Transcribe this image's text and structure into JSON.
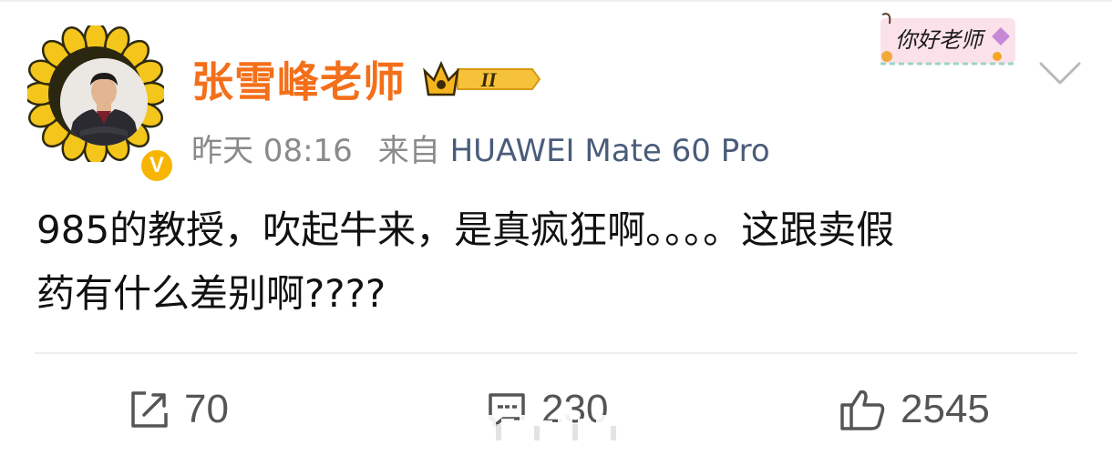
{
  "post": {
    "author": {
      "name": "张雪峰老师",
      "verified_badge": "V",
      "level_badge": "II"
    },
    "meta": {
      "time": "昨天 08:16",
      "source_prefix": "来自",
      "device": "HUAWEI Mate 60 Pro"
    },
    "sticker_text": "你好老师",
    "text_line1": "985的教授，吹起牛来，是真疯狂啊。。。。这跟卖假",
    "text_line2": "药有什么差别啊????",
    "actions": {
      "share_count": "70",
      "comment_count": "230",
      "like_count": "2545"
    }
  },
  "colors": {
    "name": "#f46f1a",
    "device_link": "#4a5c7a",
    "meta": "#8a8a8a",
    "sunflower_petal": "#f4c51a",
    "verified_badge": "#f7b500"
  },
  "icons": [
    "sunflower-frame",
    "crown-icon",
    "chevron-down-icon",
    "share-icon",
    "comment-icon",
    "like-icon"
  ]
}
